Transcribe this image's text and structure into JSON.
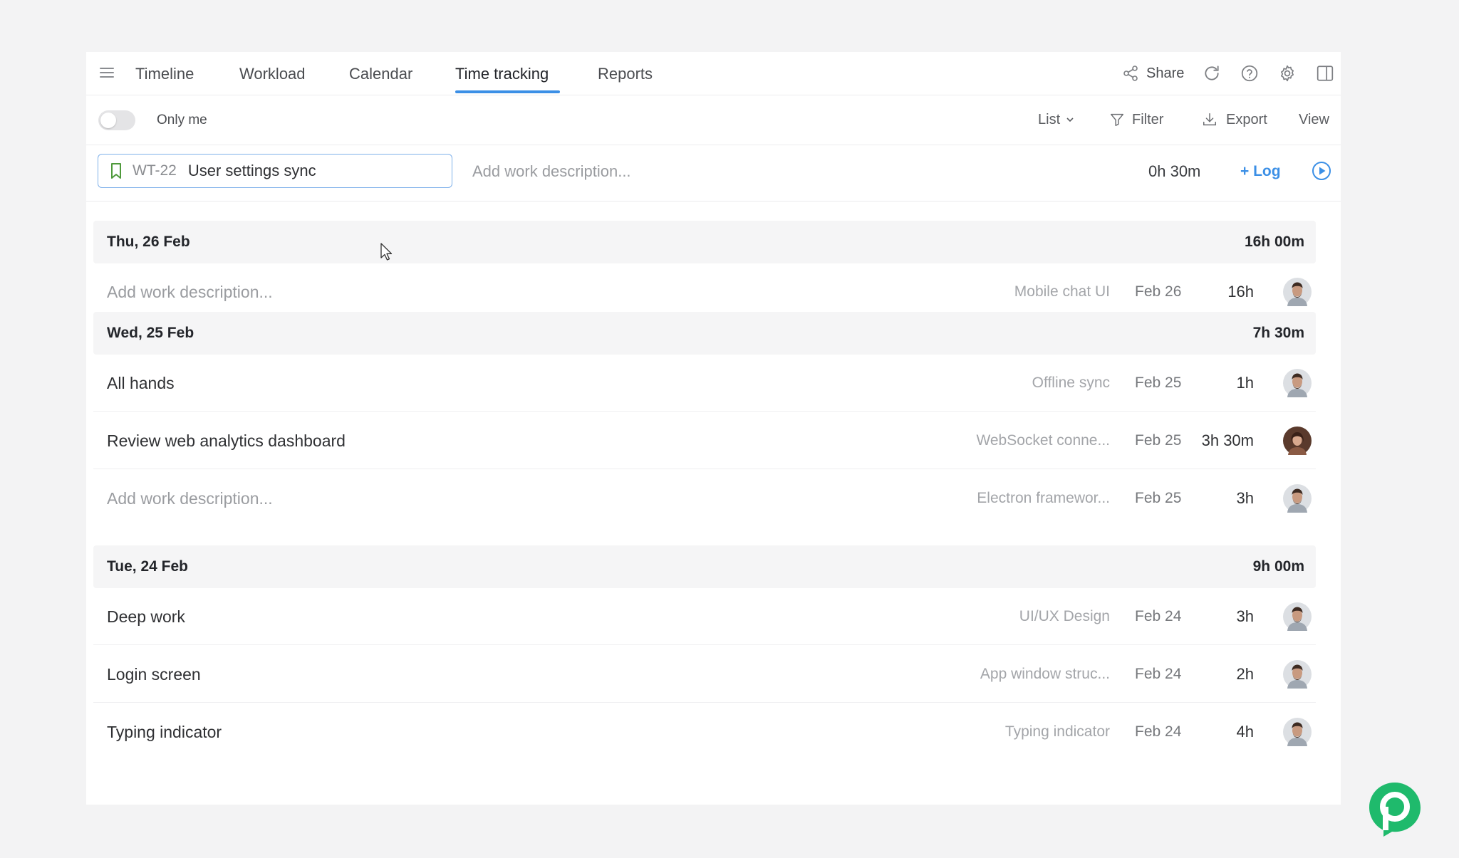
{
  "nav": {
    "tabs": [
      {
        "label": "Timeline"
      },
      {
        "label": "Workload"
      },
      {
        "label": "Calendar"
      },
      {
        "label": "Time tracking",
        "active": true
      },
      {
        "label": "Reports"
      }
    ],
    "share_label": "Share",
    "icons": [
      "menu-icon",
      "share-icon",
      "refresh-icon",
      "help-icon",
      "settings-icon",
      "side-panel-icon"
    ]
  },
  "toolbar": {
    "only_me_label": "Only me",
    "only_me_on": false,
    "list_label": "List",
    "filter_label": "Filter",
    "export_label": "Export",
    "view_label": "View"
  },
  "entry": {
    "task_key": "WT-22",
    "task_name": "User settings sync",
    "description_placeholder": "Add work description...",
    "duration": "0h 30m",
    "log_label": "+ Log"
  },
  "groups": [
    {
      "date": "Thu, 26 Feb",
      "total": "16h 00m",
      "entries": [
        {
          "description": "Add work description...",
          "placeholder": true,
          "task": "Mobile chat UI",
          "date": "Feb 26",
          "duration": "16h",
          "avatar": "male"
        }
      ]
    },
    {
      "date": "Wed, 25 Feb",
      "total": "7h 30m",
      "entries": [
        {
          "description": "All hands",
          "placeholder": false,
          "task": "Offline sync",
          "date": "Feb 25",
          "duration": "1h",
          "avatar": "male"
        },
        {
          "description": "Review web analytics dashboard",
          "placeholder": false,
          "task": "WebSocket conne...",
          "date": "Feb 25",
          "duration": "3h 30m",
          "avatar": "female"
        },
        {
          "description": "Add work description...",
          "placeholder": true,
          "task": "Electron framewor...",
          "date": "Feb 25",
          "duration": "3h",
          "avatar": "male"
        }
      ]
    },
    {
      "date": "Tue, 24 Feb",
      "total": "9h 00m",
      "entries": [
        {
          "description": "Deep work",
          "placeholder": false,
          "task": "UI/UX Design",
          "date": "Feb 24",
          "duration": "3h",
          "avatar": "male"
        },
        {
          "description": "Login screen",
          "placeholder": false,
          "task": "App window struc...",
          "date": "Feb 24",
          "duration": "2h",
          "avatar": "male"
        },
        {
          "description": "Typing indicator",
          "placeholder": false,
          "task": "Typing indicator",
          "date": "Feb 24",
          "duration": "4h",
          "avatar": "male"
        }
      ]
    }
  ],
  "colors": {
    "accent": "#3b8fe6",
    "brand_green": "#1fba6c",
    "header_bg": "#f5f5f6",
    "page_bg": "#f3f3f4"
  }
}
